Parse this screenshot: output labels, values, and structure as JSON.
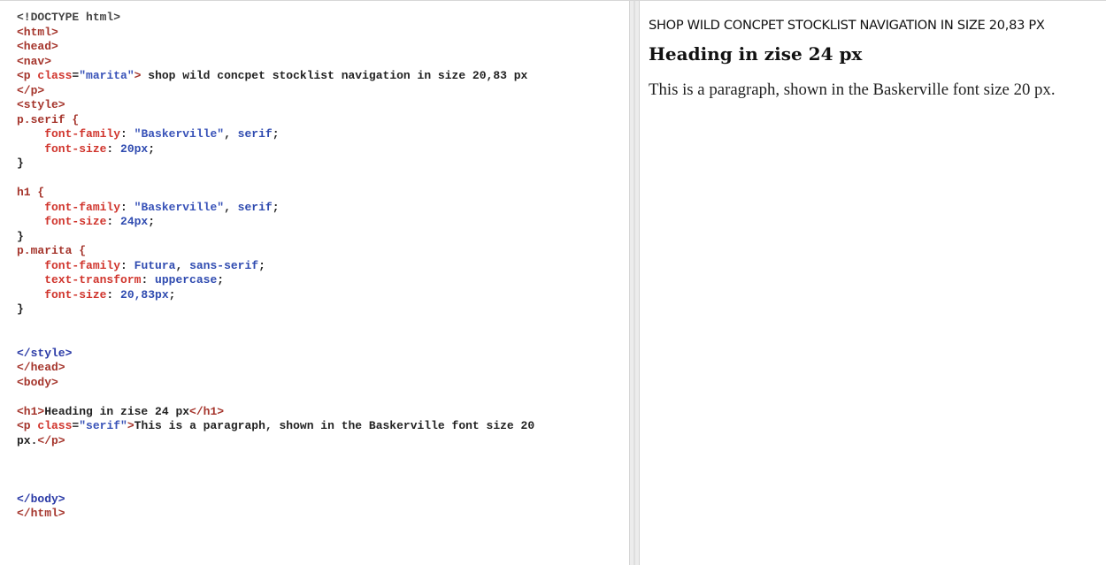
{
  "editor": {
    "lines": [
      [
        {
          "t": "<!DOCTYPE html>",
          "c": "doc"
        }
      ],
      [
        {
          "t": "<html>",
          "c": "tag"
        }
      ],
      [
        {
          "t": "<head>",
          "c": "tag"
        }
      ],
      [
        {
          "t": "<nav>",
          "c": "tag"
        }
      ],
      [
        {
          "t": "<p ",
          "c": "tag"
        },
        {
          "t": "class",
          "c": "attr"
        },
        {
          "t": "=",
          "c": "plain"
        },
        {
          "t": "\"marita\"",
          "c": "str"
        },
        {
          "t": ">",
          "c": "tag"
        },
        {
          "t": " shop wild concpet stocklist navigation in size 20,83 px",
          "c": "plain"
        }
      ],
      [
        {
          "t": "</p>",
          "c": "tag"
        }
      ],
      [
        {
          "t": "<style>",
          "c": "tag"
        }
      ],
      [
        {
          "t": "p.serif {",
          "c": "sel"
        }
      ],
      [
        {
          "t": "    font-family",
          "c": "prop"
        },
        {
          "t": ": ",
          "c": "plain"
        },
        {
          "t": "\"Baskerville\"",
          "c": "str"
        },
        {
          "t": ", ",
          "c": "plain"
        },
        {
          "t": "serif",
          "c": "val"
        },
        {
          "t": ";",
          "c": "plain"
        }
      ],
      [
        {
          "t": "    font-size",
          "c": "prop"
        },
        {
          "t": ": ",
          "c": "plain"
        },
        {
          "t": "20px",
          "c": "val"
        },
        {
          "t": ";",
          "c": "plain"
        }
      ],
      [
        {
          "t": "}",
          "c": "plain"
        }
      ],
      [
        {
          "t": "",
          "c": "plain"
        }
      ],
      [
        {
          "t": "h1 {",
          "c": "sel"
        }
      ],
      [
        {
          "t": "    font-family",
          "c": "prop"
        },
        {
          "t": ": ",
          "c": "plain"
        },
        {
          "t": "\"Baskerville\"",
          "c": "str"
        },
        {
          "t": ", ",
          "c": "plain"
        },
        {
          "t": "serif",
          "c": "val"
        },
        {
          "t": ";",
          "c": "plain"
        }
      ],
      [
        {
          "t": "    font-size",
          "c": "prop"
        },
        {
          "t": ": ",
          "c": "plain"
        },
        {
          "t": "24px",
          "c": "val"
        },
        {
          "t": ";",
          "c": "plain"
        }
      ],
      [
        {
          "t": "}",
          "c": "plain"
        }
      ],
      [
        {
          "t": "p.marita {",
          "c": "sel"
        }
      ],
      [
        {
          "t": "    font-family",
          "c": "prop"
        },
        {
          "t": ": ",
          "c": "plain"
        },
        {
          "t": "Futura",
          "c": "val"
        },
        {
          "t": ", ",
          "c": "plain"
        },
        {
          "t": "sans-serif",
          "c": "val"
        },
        {
          "t": ";",
          "c": "plain"
        }
      ],
      [
        {
          "t": "    text-transform",
          "c": "prop"
        },
        {
          "t": ": ",
          "c": "plain"
        },
        {
          "t": "uppercase",
          "c": "val"
        },
        {
          "t": ";",
          "c": "plain"
        }
      ],
      [
        {
          "t": "    font-size",
          "c": "prop"
        },
        {
          "t": ": ",
          "c": "plain"
        },
        {
          "t": "20,83px",
          "c": "val"
        },
        {
          "t": ";",
          "c": "plain"
        }
      ],
      [
        {
          "t": "}",
          "c": "plain"
        }
      ],
      [
        {
          "t": "",
          "c": "plain"
        }
      ],
      [
        {
          "t": "",
          "c": "plain"
        }
      ],
      [
        {
          "t": "</style>",
          "c": "tagblue"
        }
      ],
      [
        {
          "t": "</head>",
          "c": "tag"
        }
      ],
      [
        {
          "t": "<body>",
          "c": "tag"
        }
      ],
      [
        {
          "t": "",
          "c": "plain"
        }
      ],
      [
        {
          "t": "<h1>",
          "c": "tag"
        },
        {
          "t": "Heading in zise 24 px",
          "c": "plain"
        },
        {
          "t": "</h1>",
          "c": "tag"
        }
      ],
      [
        {
          "t": "<p ",
          "c": "tag"
        },
        {
          "t": "class",
          "c": "attr"
        },
        {
          "t": "=",
          "c": "plain"
        },
        {
          "t": "\"serif\"",
          "c": "str"
        },
        {
          "t": ">",
          "c": "tag"
        },
        {
          "t": "This is a paragraph, shown in the Baskerville font size 20",
          "c": "plain"
        }
      ],
      [
        {
          "t": "px.",
          "c": "plain"
        },
        {
          "t": "</p>",
          "c": "tag"
        }
      ],
      [
        {
          "t": "",
          "c": "plain"
        }
      ],
      [
        {
          "t": "",
          "c": "plain"
        }
      ],
      [
        {
          "t": "",
          "c": "plain"
        }
      ],
      [
        {
          "t": "</body>",
          "c": "tagblue"
        }
      ],
      [
        {
          "t": "</html>",
          "c": "tag"
        }
      ]
    ]
  },
  "preview": {
    "nav_text": "shop wild concpet stocklist navigation in size 20,83 px",
    "heading": "Heading in zise 24 px",
    "paragraph": "This is a paragraph, shown in the Baskerville font size 20 px."
  }
}
